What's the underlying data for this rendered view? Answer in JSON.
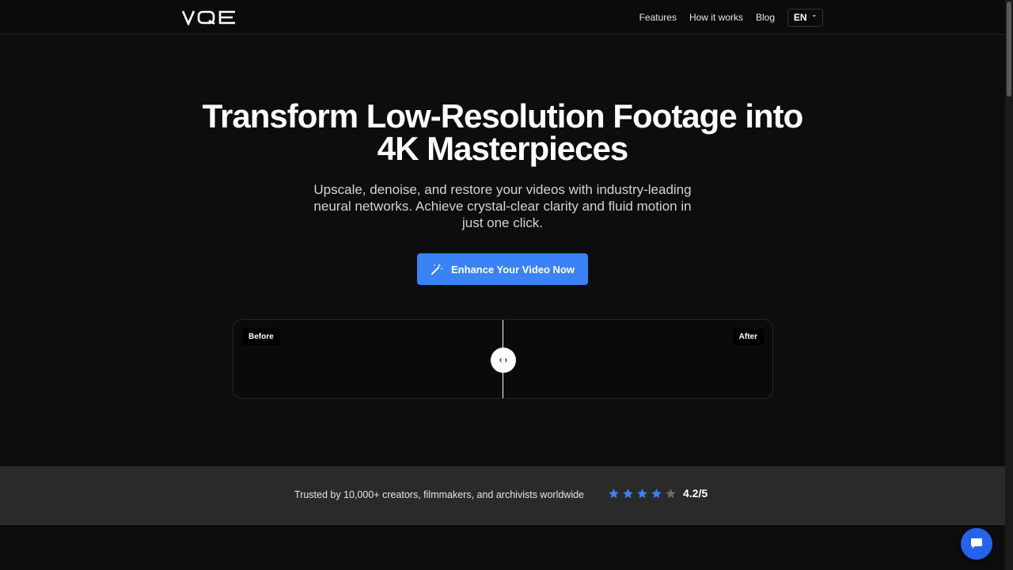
{
  "header": {
    "logo_text": "VQE",
    "nav": [
      {
        "label": "Features"
      },
      {
        "label": "How it works"
      },
      {
        "label": "Blog"
      }
    ],
    "language": "EN"
  },
  "hero": {
    "title_line1": "Transform Low-Resolution Footage into",
    "title_line2": "4K Masterpieces",
    "subtitle": "Upscale, denoise, and restore your videos with industry-leading neural networks. Achieve crystal-clear clarity and fluid motion in just one click.",
    "cta_label": "Enhance Your Video Now"
  },
  "compare": {
    "before_label": "Before",
    "after_label": "After",
    "slider_position_percent": 50
  },
  "trust": {
    "text": "Trusted by 10,000+ creators, filmmakers, and archivists worldwide",
    "stars_filled": 4,
    "stars_total": 5,
    "rating": "4.2/5"
  },
  "colors": {
    "accent": "#3b82f6",
    "background": "#0d0d0d",
    "star_filled": "#3b82f6",
    "star_empty": "#6b6b6b"
  }
}
